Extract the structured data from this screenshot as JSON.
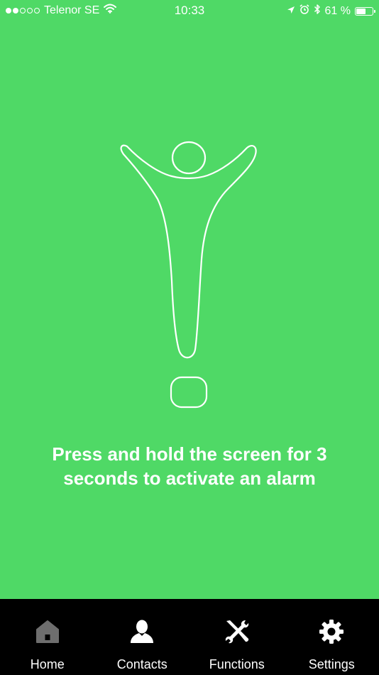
{
  "status_bar": {
    "carrier": "Telenor SE",
    "time": "10:33",
    "battery_percent": "61 %",
    "battery_level": 0.61,
    "signal_bars_filled": 2,
    "signal_bars_total": 5,
    "icons": [
      "wifi-icon",
      "location-arrow-icon",
      "alarm-clock-icon",
      "bluetooth-icon",
      "battery-icon"
    ]
  },
  "main": {
    "background_color": "#4fd966",
    "figure_icon": "person-exclamation-icon",
    "instruction": "Press and hold the screen for 3 seconds to activate an alarm"
  },
  "tab_bar": {
    "background_color": "#000000",
    "active_icon_color": "#6e6e6e",
    "icon_color": "#ffffff",
    "tabs": [
      {
        "label": "Home",
        "icon": "home-icon",
        "active": true
      },
      {
        "label": "Contacts",
        "icon": "person-icon",
        "active": false
      },
      {
        "label": "Functions",
        "icon": "tools-icon",
        "active": false
      },
      {
        "label": "Settings",
        "icon": "gear-icon",
        "active": false
      }
    ]
  }
}
